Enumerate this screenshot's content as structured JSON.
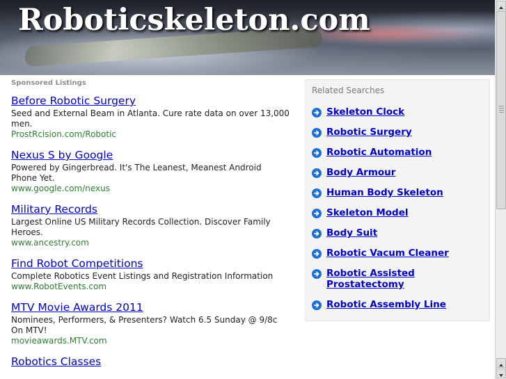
{
  "header": {
    "site_title": "Roboticskeleton.com"
  },
  "sponsored": {
    "label": "Sponsored Listings",
    "ads": [
      {
        "title": "Before Robotic Surgery",
        "description": "Seed and External Beam in Atlanta. Cure rate data on over 13,000 men.",
        "url": "ProstRcision.com/Robotic"
      },
      {
        "title": "Nexus S by Google",
        "description": "Powered by Gingerbread. It's The Leanest, Meanest Android Phone Yet.",
        "url": "www.google.com/nexus"
      },
      {
        "title": "Military Records",
        "description": "Largest Online US Military Records Collection. Discover Family Heroes.",
        "url": "www.ancestry.com"
      },
      {
        "title": "Find Robot Competitions",
        "description": "Complete Robotics Event Listings and Registration Information",
        "url": "www.RobotEvents.com"
      },
      {
        "title": "MTV Movie Awards 2011",
        "description": "Nominees, Performers, & Presenters? Watch 6.5 Sunday @ 9/8c On MTV!",
        "url": "movieawards.MTV.com"
      },
      {
        "title": "Robotics Classes",
        "description": "",
        "url": ""
      }
    ]
  },
  "related": {
    "title": "Related Searches",
    "items": [
      "Skeleton Clock",
      "Robotic Surgery",
      "Robotic Automation",
      "Body Armour",
      "Human Body Skeleton",
      "Skeleton Model",
      "Body Suit",
      "Robotic Vacum Cleaner",
      "Robotic Assisted Prostatectomy",
      "Robotic Assembly Line"
    ],
    "icon": "arrow-right-circle-icon",
    "icon_color": "#1f6fd1",
    "link_color": "#0000c8"
  },
  "colors": {
    "ad_url": "#2e7d32",
    "ad_link": "#0000c8"
  }
}
